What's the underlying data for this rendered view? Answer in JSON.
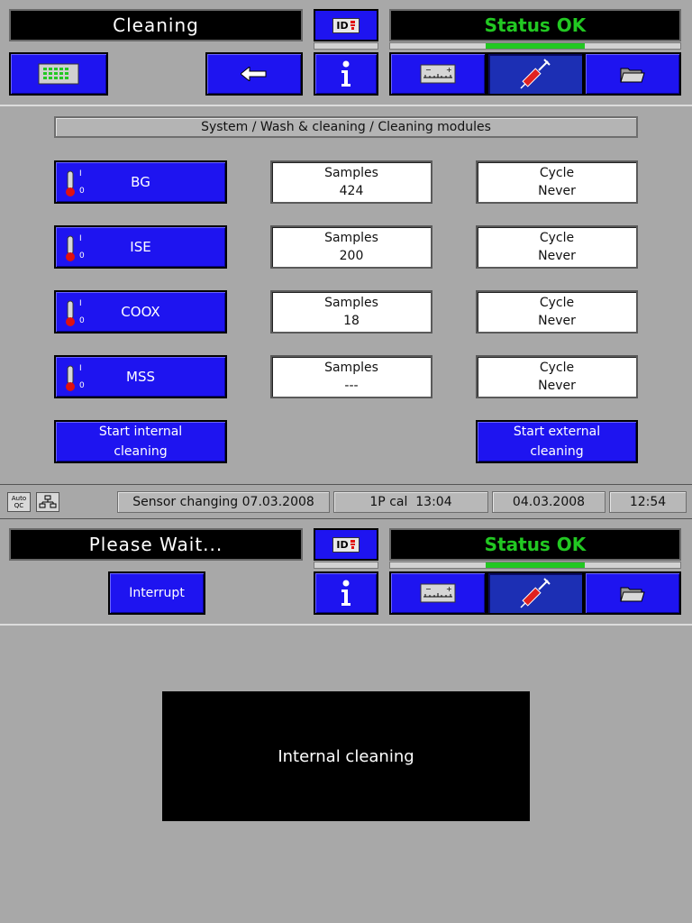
{
  "header": {
    "title": "Cleaning",
    "id_label": "ID",
    "status": "Status OK"
  },
  "breadcrumb": "System / Wash & cleaning / Cleaning modules",
  "modules": [
    {
      "name": "BG",
      "samples_label": "Samples",
      "samples": "424",
      "cycle_label": "Cycle",
      "cycle": "Never"
    },
    {
      "name": "ISE",
      "samples_label": "Samples",
      "samples": "200",
      "cycle_label": "Cycle",
      "cycle": "Never"
    },
    {
      "name": "COOX",
      "samples_label": "Samples",
      "samples": "18",
      "cycle_label": "Cycle",
      "cycle": "Never"
    },
    {
      "name": "MSS",
      "samples_label": "Samples",
      "samples": "---",
      "cycle_label": "Cycle",
      "cycle": "Never"
    }
  ],
  "thermo_scale": {
    "top": "I",
    "bottom": "0"
  },
  "actions": {
    "start_internal_line1": "Start internal",
    "start_internal_line2": "cleaning",
    "start_external_line1": "Start external",
    "start_external_line2": "cleaning"
  },
  "statusbar": {
    "autoqc_line1": "Auto",
    "autoqc_line2": "QC",
    "sensor": "Sensor changing 07.03.2008",
    "cal": "1P cal  13:04",
    "date": "04.03.2008",
    "time": "12:54"
  },
  "wait_header": {
    "title": "Please Wait...",
    "id_label": "ID",
    "status": "Status OK",
    "interrupt_label": "Interrupt"
  },
  "message": "Internal cleaning",
  "icons": {
    "menu": "keyboard-grid-icon",
    "back": "arrow-left-icon",
    "info": "info-icon",
    "calibration": "scale-ruler-icon",
    "syringe": "syringe-icon",
    "folder": "folder-icon",
    "thermometer": "thermometer-icon",
    "network": "network-icon"
  },
  "colors": {
    "button_blue": "#1e14f0",
    "status_green": "#22c822",
    "background": "#a8a8a8"
  }
}
